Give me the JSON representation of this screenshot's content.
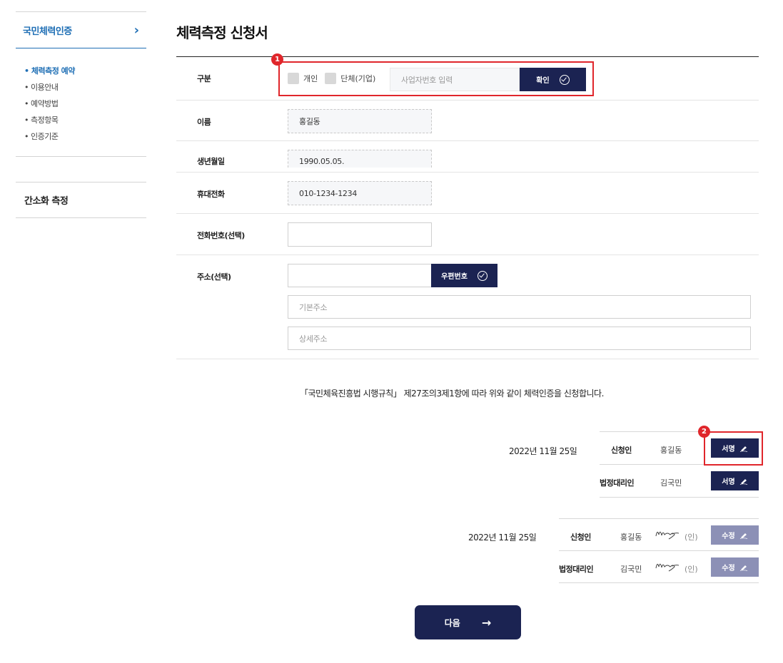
{
  "sidebar": {
    "heading": "국민체력인증",
    "items": [
      {
        "label": "• 체력측정 예약",
        "active": true
      },
      {
        "label": "• 이용안내"
      },
      {
        "label": "• 예약방법"
      },
      {
        "label": "• 측정항목"
      },
      {
        "label": "• 인증기준"
      }
    ],
    "second_heading": "간소화 측정"
  },
  "page": {
    "title": "체력측정 신청서"
  },
  "form": {
    "category": {
      "label": "구분",
      "opt_individual": "개인",
      "opt_group": "단체(기업)",
      "biz_placeholder": "사업자번호 입력",
      "confirm_label": "확인"
    },
    "name": {
      "label": "이름",
      "value": "홍길동"
    },
    "birth": {
      "label": "생년월일",
      "value": "1990.05.05."
    },
    "mobile": {
      "label": "휴대전화",
      "value": "010-1234-1234"
    },
    "phone": {
      "label": "전화번호(선택)",
      "value": ""
    },
    "address": {
      "label": "주소(선택)",
      "zip_button": "우편번호",
      "base_placeholder": "기본주소",
      "detail_placeholder": "상세주소"
    }
  },
  "notice": "「국민체육진흥법 시행규칙」 제27조의3제1항에 따라 위와 같이 체력인증을 신청합니다.",
  "sign_block_1": {
    "date": "2022년 11월 25일",
    "rows": [
      {
        "role": "신청인",
        "name": "홍길동",
        "button": "서명"
      },
      {
        "role": "법정대리인",
        "name": "김국민",
        "button": "서명"
      }
    ]
  },
  "sign_block_2": {
    "date": "2022년 11월 25일",
    "rows": [
      {
        "role": "신청인",
        "name": "홍길동",
        "mark": "(인)",
        "button": "수정"
      },
      {
        "role": "법정대리인",
        "name": "김국민",
        "mark": "(인)",
        "button": "수정"
      }
    ]
  },
  "badges": {
    "one": "1",
    "two": "2"
  },
  "next_button": "다음",
  "colors": {
    "navy": "#1b2352",
    "accent_blue": "#1f6fb5",
    "highlight_red": "#e0262b",
    "muted_button": "#8c90b6"
  }
}
